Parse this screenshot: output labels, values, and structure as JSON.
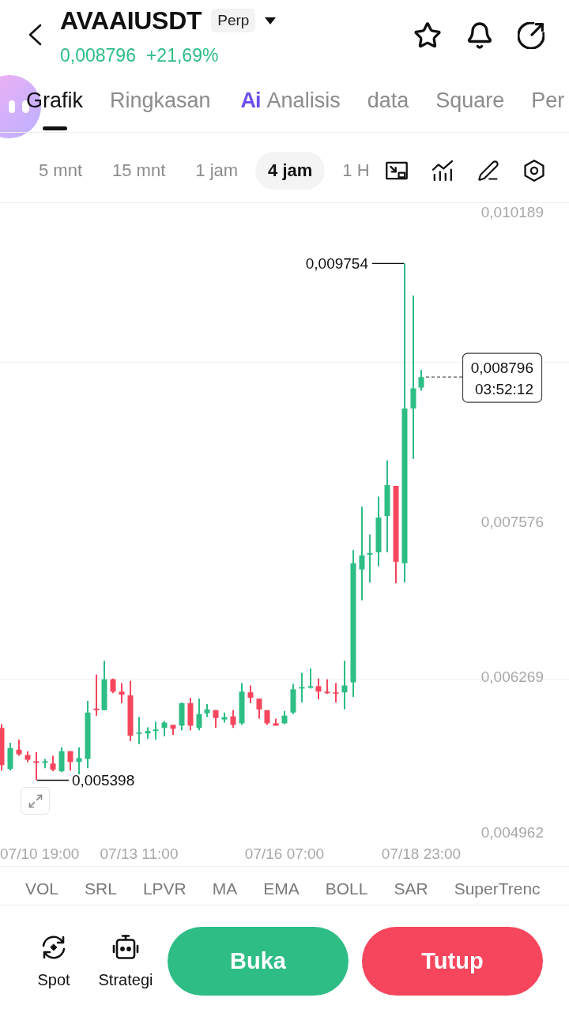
{
  "header": {
    "title": "AVAAIUSDT",
    "badge": "Perp",
    "price": "0,008796",
    "change": "+21,69%"
  },
  "tabs": [
    {
      "label": "Grafik",
      "selected": true,
      "kind": "text"
    },
    {
      "label": "Ringkasan",
      "selected": false,
      "kind": "text"
    },
    {
      "label": "Analisis",
      "selected": false,
      "kind": "ai",
      "badge": "Ai"
    },
    {
      "label": "data",
      "selected": false,
      "kind": "text"
    },
    {
      "label": "Square",
      "selected": false,
      "kind": "text"
    },
    {
      "label": "Per",
      "selected": false,
      "kind": "text"
    }
  ],
  "timeframes": [
    {
      "label": "5 mnt",
      "selected": false
    },
    {
      "label": "15 mnt",
      "selected": false
    },
    {
      "label": "1 jam",
      "selected": false
    },
    {
      "label": "4 jam",
      "selected": true
    },
    {
      "label": "1 H",
      "selected": false
    }
  ],
  "chart": {
    "chart_data": {
      "type": "candlestick",
      "categories": [
        null,
        null,
        null,
        null,
        null,
        null,
        null,
        null,
        null,
        null,
        null,
        null,
        null,
        null,
        null,
        null,
        "07/13 11:00",
        null,
        null,
        null,
        null,
        null,
        null,
        null,
        null,
        null,
        null,
        null,
        null,
        null,
        null,
        null,
        null,
        "07/16 07:00",
        null,
        null,
        null,
        null,
        null,
        null,
        null,
        null,
        null,
        null,
        null,
        null,
        null,
        null,
        null,
        "07/18 23:00"
      ],
      "ohlc": [
        [
          0.005839,
          0.005871,
          0.00548,
          0.005526
        ],
        [
          0.005493,
          0.005715,
          0.00548,
          0.005669
        ],
        [
          0.005656,
          0.005741,
          0.005604,
          0.005617
        ],
        [
          0.005611,
          0.005643,
          0.005552,
          0.005571
        ],
        [
          0.005558,
          0.005637,
          0.005398,
          0.005545
        ],
        [
          0.005545,
          0.005578,
          0.0055,
          0.005558
        ],
        [
          0.005539,
          0.005604,
          0.005474,
          0.005487
        ],
        [
          0.005474,
          0.005676,
          0.005467,
          0.005643
        ],
        [
          0.005643,
          0.005643,
          0.00548,
          0.005552
        ],
        [
          0.005552,
          0.005676,
          0.005448,
          0.005585
        ],
        [
          0.005578,
          0.006067,
          0.0055,
          0.005969
        ],
        [
          0.006002,
          0.006289,
          0.005943,
          0.005989
        ],
        [
          0.005989,
          0.006406,
          0.005989,
          0.006249
        ],
        [
          0.006249,
          0.006256,
          0.006132,
          0.006145
        ],
        [
          0.006145,
          0.006217,
          0.006047,
          0.006119
        ],
        [
          0.006113,
          0.006236,
          0.005728,
          0.005774
        ],
        [
          0.005793,
          0.00593,
          0.005702,
          0.0058
        ],
        [
          0.005793,
          0.005845,
          0.005748,
          0.005813
        ],
        [
          0.005813,
          0.005891,
          0.005741,
          0.005826
        ],
        [
          0.005839,
          0.005897,
          0.005767,
          0.005884
        ],
        [
          0.005865,
          0.005865,
          0.00578,
          0.005832
        ],
        [
          0.005858,
          0.006054,
          0.005819,
          0.006047
        ],
        [
          0.006047,
          0.006093,
          0.005819,
          0.005858
        ],
        [
          0.005839,
          0.006086,
          0.005819,
          0.005956
        ],
        [
          0.005963,
          0.006041,
          0.00593,
          0.005995
        ],
        [
          0.005989,
          0.005989,
          0.005839,
          0.005923
        ],
        [
          0.00591,
          0.005969,
          0.005884,
          0.00593
        ],
        [
          0.005937,
          0.005989,
          0.005839,
          0.005865
        ],
        [
          0.005878,
          0.006217,
          0.005865,
          0.006145
        ],
        [
          0.006139,
          0.006197,
          0.006047,
          0.006093
        ],
        [
          0.006086,
          0.006086,
          0.005917,
          0.005995
        ],
        [
          0.005989,
          0.005989,
          0.005865,
          0.005878
        ],
        [
          0.005878,
          0.005917,
          0.005858,
          0.005858
        ],
        [
          0.005878,
          0.005982,
          0.005871,
          0.005943
        ],
        [
          0.005969,
          0.00621,
          0.005956,
          0.006165
        ],
        [
          0.006171,
          0.006302,
          0.006054,
          0.006184
        ],
        [
          0.006178,
          0.006341,
          0.006171,
          0.006191
        ],
        [
          0.006191,
          0.006256,
          0.00608,
          0.006145
        ],
        [
          0.006145,
          0.006249,
          0.006126,
          0.006132
        ],
        [
          0.006139,
          0.006217,
          0.006054,
          0.006132
        ],
        [
          0.006139,
          0.006406,
          0.005995,
          0.006197
        ],
        [
          0.006223,
          0.007338,
          0.0061,
          0.007227
        ],
        [
          0.007175,
          0.007703,
          0.006914,
          0.007293
        ],
        [
          0.007299,
          0.007469,
          0.007064,
          0.007312
        ],
        [
          0.007319,
          0.007788,
          0.007201,
          0.007612
        ],
        [
          0.007625,
          0.008094,
          0.007319,
          0.007886
        ],
        [
          0.007879,
          0.007879,
          0.007058,
          0.00724
        ],
        [
          0.007227,
          0.009754,
          0.007064,
          0.008531
        ],
        [
          0.008531,
          0.009483,
          0.008107,
          0.008701
        ],
        [
          0.008707,
          0.008857,
          0.008681,
          0.008796
        ]
      ],
      "ylim": [
        0.004962,
        0.010189
      ],
      "yticks": [
        {
          "value": 0.010189,
          "label": "0,010189"
        },
        {
          "value": 0.007576,
          "label": "0,007576"
        },
        {
          "value": 0.006269,
          "label": "0,006269"
        },
        {
          "value": 0.004962,
          "label": "0,004962"
        }
      ]
    },
    "x_start_label": "07/10 19:00",
    "high_label": "0,009754",
    "low_label": "0,005398",
    "last_price": "0,008796",
    "countdown": "03:52:12"
  },
  "indicators": [
    "VOL",
    "SRL",
    "LPVR",
    "MA",
    "EMA",
    "BOLL",
    "SAR",
    "SuperTrenc"
  ],
  "bottom_bar": {
    "shortcuts": [
      {
        "label": "Spot",
        "kind": "spot"
      },
      {
        "label": "Strategi",
        "kind": "strategy"
      }
    ],
    "actions": [
      {
        "label": "Buka",
        "kind": "buy"
      },
      {
        "label": "Tutup",
        "kind": "sell"
      }
    ]
  }
}
